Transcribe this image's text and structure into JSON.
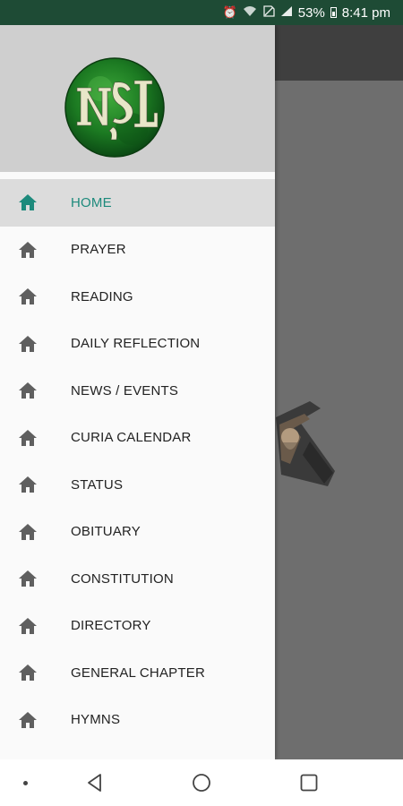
{
  "status_bar": {
    "battery": "53%",
    "time": "8:41 pm"
  },
  "colors": {
    "status_bar": "#1e4b35",
    "active_text": "#1d8a7c",
    "active_icon": "#1d8a7c",
    "icon": "#5f5f5f",
    "drawer_header": "#cfcfcf",
    "scrim": "#6e6e6e"
  },
  "logo": {
    "text": "NSL"
  },
  "menu": {
    "items": [
      {
        "label": "HOME",
        "icon": "home-icon",
        "active": true
      },
      {
        "label": "PRAYER",
        "icon": "home-icon",
        "active": false
      },
      {
        "label": "READING",
        "icon": "home-icon",
        "active": false
      },
      {
        "label": "DAILY REFLECTION",
        "icon": "home-icon",
        "active": false
      },
      {
        "label": "NEWS / EVENTS",
        "icon": "home-icon",
        "active": false
      },
      {
        "label": "CURIA CALENDAR",
        "icon": "home-icon",
        "active": false
      },
      {
        "label": "STATUS",
        "icon": "home-icon",
        "active": false
      },
      {
        "label": "OBITUARY",
        "icon": "home-icon",
        "active": false
      },
      {
        "label": "CONSTITUTION",
        "icon": "home-icon",
        "active": false
      },
      {
        "label": "DIRECTORY",
        "icon": "home-icon",
        "active": false
      },
      {
        "label": "GENERAL CHAPTER",
        "icon": "home-icon",
        "active": false
      },
      {
        "label": "HYMNS",
        "icon": "home-icon",
        "active": false
      }
    ]
  },
  "nav_bar": {
    "icons": [
      "back-icon",
      "home-circle-icon",
      "recents-icon"
    ]
  }
}
